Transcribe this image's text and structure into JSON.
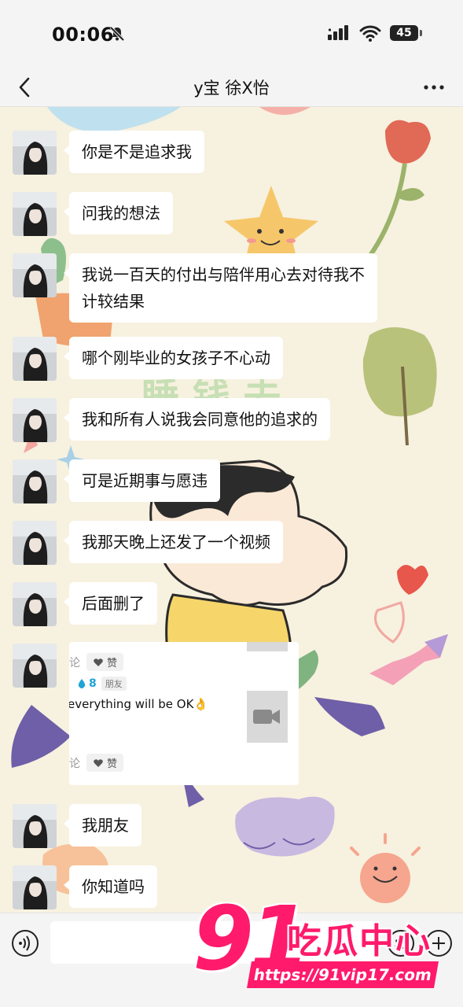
{
  "status_bar": {
    "time": "00:06",
    "battery": "45"
  },
  "header": {
    "title": "y宝 徐X怡"
  },
  "messages": [
    {
      "text": "你是不是追求我"
    },
    {
      "text": "问我的想法"
    },
    {
      "text": "我说一百天的付出与陪伴用心去对待我不计较结果"
    },
    {
      "text": "哪个刚毕业的女孩子不心动"
    },
    {
      "text": "我和所有人说我会同意他的追求的"
    },
    {
      "text": "可是近期事与愿违"
    },
    {
      "text": "我那天晚上还发了一个视频"
    },
    {
      "text": "后面删了"
    },
    {
      "text": "我朋友"
    },
    {
      "text": "你知道吗"
    }
  ],
  "moment_card": {
    "like_label_1": "赞",
    "comment_prefix_1": "论",
    "likes_count": "8",
    "friend_badge": "朋友",
    "post_text": "everything will be OK👌",
    "like_label_2": "赞",
    "comment_prefix_2": "论"
  },
  "input_bar": {
    "placeholder": ""
  },
  "watermark": {
    "brand_number": "91",
    "brand_text": "吃瓜中心",
    "url": "https://91vip17.com"
  },
  "colors": {
    "watermark_pink": "#ff1a6b",
    "bubble_bg": "#ffffff",
    "chat_bg": "#f7f1df"
  }
}
